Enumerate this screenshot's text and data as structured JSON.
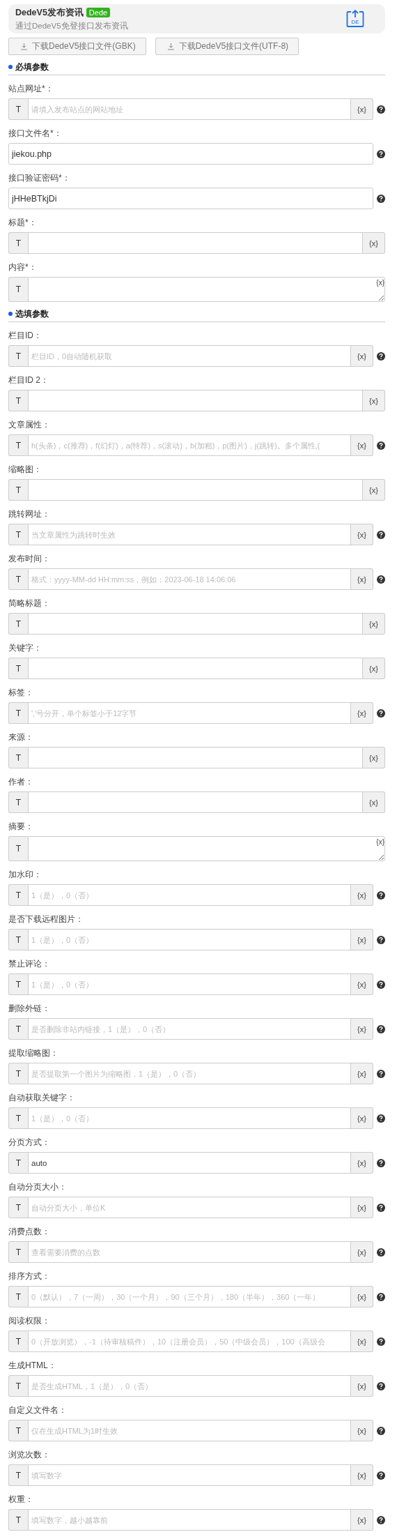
{
  "header": {
    "title": "DedeV5发布资讯",
    "badge": "Dede",
    "subtitle": "通过DedeV5免登接口发布资讯",
    "logo_text": "DE"
  },
  "download_buttons": [
    {
      "label": "下载DedeV5接口文件(GBK)"
    },
    {
      "label": "下载DedeV5接口文件(UTF-8)"
    }
  ],
  "sections": [
    {
      "title": "必填参数",
      "fields": [
        {
          "label": "站点网址*：",
          "kind": "typed",
          "prefix": "T",
          "var_button": "{x}",
          "placeholder": "请填入发布站点的网站地址",
          "help": true
        },
        {
          "label": "接口文件名*：",
          "kind": "plain",
          "value": "jiekou.php",
          "help": true
        },
        {
          "label": "接口验证密码*：",
          "kind": "plain",
          "value": "jHHeBTkjDi",
          "help": true
        },
        {
          "label": "标题*：",
          "kind": "typed",
          "prefix": "T",
          "var_button": "{x}",
          "help": false
        },
        {
          "label": "内容*：",
          "kind": "textarea",
          "prefix": "T",
          "var_button": "{x}",
          "help": false
        }
      ]
    },
    {
      "title": "选填参数",
      "fields": [
        {
          "label": "栏目ID：",
          "kind": "typed",
          "prefix": "T",
          "var_button": "{x}",
          "placeholder": "栏目ID，0自动随机获取",
          "help": true
        },
        {
          "label": "栏目ID 2：",
          "kind": "typed",
          "prefix": "T",
          "var_button": "{x}",
          "help": false
        },
        {
          "label": "文章属性：",
          "kind": "typed",
          "prefix": "T",
          "var_button": "{x}",
          "placeholder": "h(头条)，c(推荐)，f(幻灯)，a(特荐)，s(滚动)，b(加粗)，p(图片)，j(跳转)。多个属性,(",
          "help": true
        },
        {
          "label": "缩略图：",
          "kind": "typed",
          "prefix": "T",
          "var_button": "{x}",
          "help": false
        },
        {
          "label": "跳转网址：",
          "kind": "typed",
          "prefix": "T",
          "var_button": "{x}",
          "placeholder": "当文章属性为跳转时生效",
          "help": true
        },
        {
          "label": "发布时间：",
          "kind": "typed",
          "prefix": "T",
          "var_button": "{x}",
          "placeholder": "格式：yyyy-MM-dd HH:mm:ss，例如：2023-06-18 14:06:06",
          "help": true
        },
        {
          "label": "简略标题：",
          "kind": "typed",
          "prefix": "T",
          "var_button": "{x}",
          "help": false
        },
        {
          "label": "关键字：",
          "kind": "typed",
          "prefix": "T",
          "var_button": "{x}",
          "help": false
        },
        {
          "label": "标签：",
          "kind": "typed",
          "prefix": "T",
          "var_button": "{x}",
          "placeholder": "','号分开，单个标签小于12字节",
          "help": true
        },
        {
          "label": "来源：",
          "kind": "typed",
          "prefix": "T",
          "var_button": "{x}",
          "help": false
        },
        {
          "label": "作者：",
          "kind": "typed",
          "prefix": "T",
          "var_button": "{x}",
          "help": false
        },
        {
          "label": "摘要：",
          "kind": "textarea",
          "prefix": "T",
          "var_button": "{x}",
          "help": false
        },
        {
          "label": "加水印：",
          "kind": "typed",
          "prefix": "T",
          "var_button": "{x}",
          "placeholder": "1（是），0（否）",
          "help": true
        },
        {
          "label": "是否下载远程图片：",
          "kind": "typed",
          "prefix": "T",
          "var_button": "{x}",
          "placeholder": "1（是），0（否）",
          "help": true
        },
        {
          "label": "禁止评论：",
          "kind": "typed",
          "prefix": "T",
          "var_button": "{x}",
          "placeholder": "1（是），0（否）",
          "help": true
        },
        {
          "label": "删除外链：",
          "kind": "typed",
          "prefix": "T",
          "var_button": "{x}",
          "placeholder": "是否删除非站内链接，1（是），0（否）",
          "help": true
        },
        {
          "label": "提取缩略图：",
          "kind": "typed",
          "prefix": "T",
          "var_button": "{x}",
          "placeholder": "是否提取第一个图片为缩略图，1（是），0（否）",
          "help": true
        },
        {
          "label": "自动获取关键字：",
          "kind": "typed",
          "prefix": "T",
          "var_button": "{x}",
          "placeholder": "1（是），0（否）",
          "help": true
        },
        {
          "label": "分页方式：",
          "kind": "typed",
          "prefix": "T",
          "var_button": "{x}",
          "value": "auto",
          "help": true
        },
        {
          "label": "自动分页大小：",
          "kind": "typed",
          "prefix": "T",
          "var_button": "{x}",
          "placeholder": "自动分页大小，单位K",
          "help": true
        },
        {
          "label": "消费点数：",
          "kind": "typed",
          "prefix": "T",
          "var_button": "{x}",
          "placeholder": "查看需要消费的点数",
          "help": true
        },
        {
          "label": "排序方式：",
          "kind": "typed",
          "prefix": "T",
          "var_button": "{x}",
          "placeholder": "0（默认），7（一周），30（一个月），90（三个月），180（半年），360（一年）",
          "help": true
        },
        {
          "label": "阅读权限：",
          "kind": "typed",
          "prefix": "T",
          "var_button": "{x}",
          "placeholder": "0（开放浏览），-1（待审核稿件），10（注册会员），50（中级会员），100（高级会",
          "help": true
        },
        {
          "label": "生成HTML：",
          "kind": "typed",
          "prefix": "T",
          "var_button": "{x}",
          "placeholder": "是否生成HTML，1（是），0（否）",
          "help": true
        },
        {
          "label": "自定义文件名：",
          "kind": "typed",
          "prefix": "T",
          "var_button": "{x}",
          "placeholder": "仅在生成HTML为1时生效",
          "help": true
        },
        {
          "label": "浏览次数：",
          "kind": "typed",
          "prefix": "T",
          "var_button": "{x}",
          "placeholder": "填写数字",
          "help": true
        },
        {
          "label": "权重：",
          "kind": "typed",
          "prefix": "T",
          "var_button": "{x}",
          "placeholder": "填写数字，越小越靠前",
          "help": true
        }
      ]
    }
  ]
}
